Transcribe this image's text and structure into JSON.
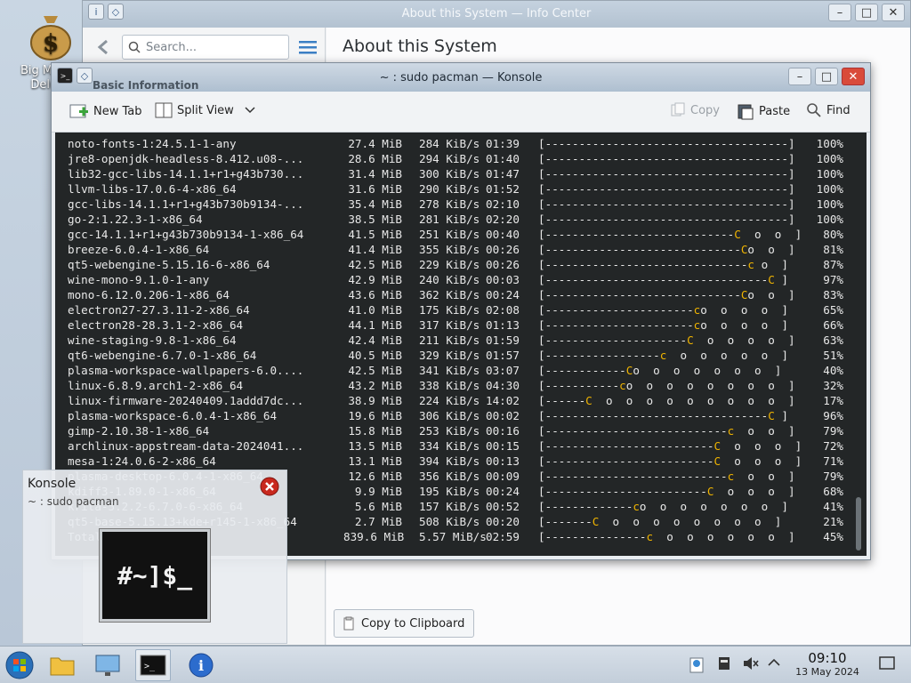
{
  "desktop": {
    "icon_label": "Big Money Deluxe"
  },
  "info_center": {
    "window_title": "About this System — Info Center",
    "search_placeholder": "Search...",
    "page_heading": "About this System",
    "section_label": "Basic Information",
    "copy_button": "Copy to Clipboard"
  },
  "konsole": {
    "window_title": "~ : sudo pacman — Konsole",
    "toolbar": {
      "new_tab": "New Tab",
      "split_view": "Split View",
      "copy": "Copy",
      "paste": "Paste",
      "find": "Find"
    },
    "rows": [
      {
        "name": "noto-fonts-1:24.5.1-1-any",
        "size": "27.4 MiB",
        "speed": "284 KiB/s",
        "time": "01:39",
        "bar": "[------------------------------------]",
        "pct": "100%"
      },
      {
        "name": "jre8-openjdk-headless-8.412.u08-...",
        "size": "28.6 MiB",
        "speed": "294 KiB/s",
        "time": "01:40",
        "bar": "[------------------------------------]",
        "pct": "100%"
      },
      {
        "name": "lib32-gcc-libs-14.1.1+r1+g43b730...",
        "size": "31.4 MiB",
        "speed": "300 KiB/s",
        "time": "01:47",
        "bar": "[------------------------------------]",
        "pct": "100%"
      },
      {
        "name": "llvm-libs-17.0.6-4-x86_64",
        "size": "31.6 MiB",
        "speed": "290 KiB/s",
        "time": "01:52",
        "bar": "[------------------------------------]",
        "pct": "100%"
      },
      {
        "name": "gcc-libs-14.1.1+r1+g43b730b9134-...",
        "size": "35.4 MiB",
        "speed": "278 KiB/s",
        "time": "02:10",
        "bar": "[------------------------------------]",
        "pct": "100%"
      },
      {
        "name": "go-2:1.22.3-1-x86_64",
        "size": "38.5 MiB",
        "speed": "281 KiB/s",
        "time": "02:20",
        "bar": "[------------------------------------]",
        "pct": "100%"
      },
      {
        "name": "gcc-14.1.1+r1+g43b730b9134-1-x86_64",
        "size": "41.5 MiB",
        "speed": "251 KiB/s",
        "time": "00:40",
        "bar": "[----------------------------C  o  o  ]",
        "pct": "80%"
      },
      {
        "name": "breeze-6.0.4-1-x86_64",
        "size": "41.4 MiB",
        "speed": "355 KiB/s",
        "time": "00:26",
        "bar": "[-----------------------------Co  o  ]",
        "pct": "81%"
      },
      {
        "name": "qt5-webengine-5.15.16-6-x86_64",
        "size": "42.5 MiB",
        "speed": "229 KiB/s",
        "time": "00:26",
        "bar": "[------------------------------c o  ]",
        "pct": "87%"
      },
      {
        "name": "wine-mono-9.1.0-1-any",
        "size": "42.9 MiB",
        "speed": "240 KiB/s",
        "time": "00:03",
        "bar": "[---------------------------------C ]",
        "pct": "97%"
      },
      {
        "name": "mono-6.12.0.206-1-x86_64",
        "size": "43.6 MiB",
        "speed": "362 KiB/s",
        "time": "00:24",
        "bar": "[-----------------------------Co  o  ]",
        "pct": "83%"
      },
      {
        "name": "electron27-27.3.11-2-x86_64",
        "size": "41.0 MiB",
        "speed": "175 KiB/s",
        "time": "02:08",
        "bar": "[----------------------co  o  o  o  ]",
        "pct": "65%"
      },
      {
        "name": "electron28-28.3.1-2-x86_64",
        "size": "44.1 MiB",
        "speed": "317 KiB/s",
        "time": "01:13",
        "bar": "[----------------------co  o  o  o  ]",
        "pct": "66%"
      },
      {
        "name": "wine-staging-9.8-1-x86_64",
        "size": "42.4 MiB",
        "speed": "211 KiB/s",
        "time": "01:59",
        "bar": "[---------------------C  o  o  o  o  ]",
        "pct": "63%"
      },
      {
        "name": "qt6-webengine-6.7.0-1-x86_64",
        "size": "40.5 MiB",
        "speed": "329 KiB/s",
        "time": "01:57",
        "bar": "[-----------------c  o  o  o  o  o  ]",
        "pct": "51%"
      },
      {
        "name": "plasma-workspace-wallpapers-6.0....",
        "size": "42.5 MiB",
        "speed": "341 KiB/s",
        "time": "03:07",
        "bar": "[------------Co  o  o  o  o  o  o  ]",
        "pct": "40%"
      },
      {
        "name": "linux-6.8.9.arch1-2-x86_64",
        "size": "43.2 MiB",
        "speed": "338 KiB/s",
        "time": "04:30",
        "bar": "[-----------co  o  o  o  o  o  o  o  ]",
        "pct": "32%"
      },
      {
        "name": "linux-firmware-20240409.1addd7dc...",
        "size": "38.9 MiB",
        "speed": "224 KiB/s",
        "time": "14:02",
        "bar": "[------C  o  o  o  o  o  o  o  o  o  ]",
        "pct": "17%"
      },
      {
        "name": "plasma-workspace-6.0.4-1-x86_64",
        "size": "19.6 MiB",
        "speed": "306 KiB/s",
        "time": "00:02",
        "bar": "[---------------------------------C ]",
        "pct": "96%"
      },
      {
        "name": "gimp-2.10.38-1-x86_64",
        "size": "15.8 MiB",
        "speed": "253 KiB/s",
        "time": "00:16",
        "bar": "[---------------------------c  o  o  ]",
        "pct": "79%"
      },
      {
        "name": "archlinux-appstream-data-2024041...",
        "size": "13.5 MiB",
        "speed": "334 KiB/s",
        "time": "00:15",
        "bar": "[-------------------------C  o  o  o  ]",
        "pct": "72%"
      },
      {
        "name": "mesa-1:24.0.6-2-x86_64",
        "size": "13.1 MiB",
        "speed": "394 KiB/s",
        "time": "00:13",
        "bar": "[-------------------------C  o  o  o  ]",
        "pct": "71%"
      },
      {
        "name": "plasma-desktop-6.0.4-1-x86_64",
        "size": "12.6 MiB",
        "speed": "356 KiB/s",
        "time": "00:09",
        "bar": "[---------------------------c  o  o  ]",
        "pct": "79%"
      },
      {
        "name": "kdiff3-1.89.0-1-x86_64",
        "size": "9.9 MiB",
        "speed": "195 KiB/s",
        "time": "00:24",
        "bar": "[------------------------C  o  o  o  ]",
        "pct": "68%"
      },
      {
        "name": "krita-5.2.2-6.7.0-6-x86_64",
        "size": "5.6 MiB",
        "speed": "157 KiB/s",
        "time": "00:52",
        "bar": "[-------------co  o  o  o  o  o  o  ]",
        "pct": "41%"
      },
      {
        "name": "qt5-base-5.15.13+kde+r145-1-x86_64",
        "size": "2.7 MiB",
        "speed": "508 KiB/s",
        "time": "00:20",
        "bar": "[-------C  o  o  o  o  o  o  o  o  ]",
        "pct": "21%"
      },
      {
        "name": "Total (15/31)",
        "size": "839.6 MiB",
        "speed": "5.57 MiB/s",
        "time": "02:59",
        "bar": "[---------------c  o  o  o  o  o  o  ]",
        "pct": "45%"
      }
    ]
  },
  "notification": {
    "title": "Konsole",
    "body": "~ : sudo pacman",
    "thumbnail_text": "#~]$_"
  },
  "taskbar": {
    "items": [
      "start-orb",
      "file-manager",
      "system-settings",
      "konsole",
      "info-center"
    ],
    "time": "09:10",
    "date": "13 May 2024"
  },
  "colors": {
    "terminal_bg": "#232627",
    "pacman_accent": "#f0b400"
  }
}
